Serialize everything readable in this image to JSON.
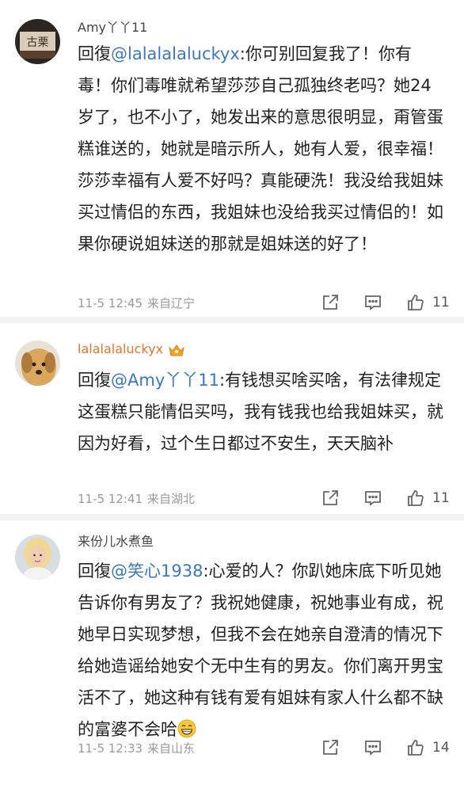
{
  "comments": [
    {
      "username": "Amy丫丫11",
      "reply_prefix": "回復",
      "mention": "@lalalalaluckyx",
      "text": ":你可别回复我了！你有毒！你们毒唯就希望莎莎自己孤独终老吗？她24岁了，也不小了，她发出来的意思很明显，甭管蛋糕谁送的，她就是暗示所人，她有人爱，很幸福！莎莎幸福有人爱不好吗？真能硬洗！我没给我姐妹买过情侣的东西，我姐妹也没给我买过情侣的！如果你硬说姐妹送的那就是姐妹送的好了！",
      "time": "11-5 12:45",
      "location": "来自辽宁",
      "likes": "11"
    },
    {
      "username": "lalalalaluckyx",
      "reply_prefix": "回復",
      "mention": "@Amy丫丫11",
      "text": ":有钱想买啥买啥，有法律规定这蛋糕只能情侣买吗，我有钱我也给我姐妹买，就因为好看，过个生日都过不安生，天天脑补",
      "time": "11-5 12:41",
      "location": "来自湖北",
      "likes": "11"
    },
    {
      "username": "来份儿水煮鱼",
      "reply_prefix": "回復",
      "mention": "@笑心1938",
      "text": ":心爱的人？你趴她床底下听见她告诉你有男友了？我祝她健康，祝她事业有成，祝她早日实现梦想，但我不会在她亲自澄清的情况下给她造谣给她安个无中生有的男友。你们离开男宝活不了，她这种有钱有爱有姐妹有家人什么都不缺的富婆不会哈",
      "time": "11-5 12:33",
      "location": "来自山东",
      "likes": "14"
    }
  ],
  "avatar1_text": "古栗",
  "icons": [
    "share-icon",
    "comment-icon",
    "like-icon",
    "vip-crown-icon",
    "grin-emoji-icon"
  ],
  "colors": {
    "mention": "#3a78c3",
    "vip_username": "#e0762f",
    "meta": "#9a9a9a",
    "divider": "#f2f2f2"
  }
}
